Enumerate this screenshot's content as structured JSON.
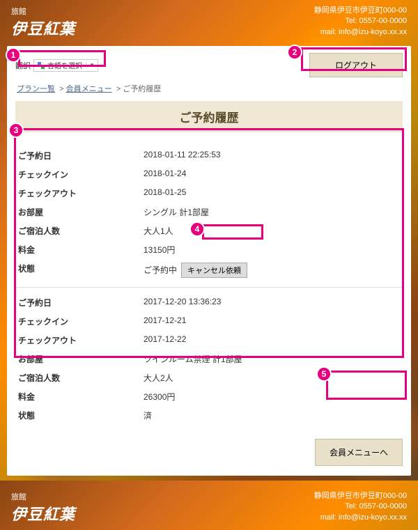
{
  "header": {
    "logo_sub": "旅館",
    "logo_main": "伊豆紅葉",
    "address": "静岡県伊豆市伊豆町000-00",
    "tel": "Tel: 0557-00-0000",
    "mail": "mail: info@izu-koyo.xx.xx"
  },
  "translate": {
    "label": "翻訳",
    "button": "言語を選択"
  },
  "logout": "ログアウト",
  "breadcrumb": {
    "plan_list": "プラン一覧",
    "member_menu": "会員メニュー",
    "current": "ご予約履歴",
    "sep": ">"
  },
  "page_title": "ご予約履歴",
  "labels": {
    "reserved_at": "ご予約日",
    "checkin": "チェックイン",
    "checkout": "チェックアウト",
    "room": "お部屋",
    "guests": "ご宿泊人数",
    "price": "料金",
    "status": "状態"
  },
  "cancel_button": "キャンセル依頼",
  "reservations": [
    {
      "reserved_at": "2018-01-11 22:25:53",
      "checkin": "2018-01-24",
      "checkout": "2018-01-25",
      "room": "シングル 計1部屋",
      "guests": "大人1人",
      "price": "13150円",
      "status": "ご予約中",
      "cancelable": true
    },
    {
      "reserved_at": "2017-12-20 13:36:23",
      "checkin": "2017-12-21",
      "checkout": "2017-12-22",
      "room": "ツインルーム禁煙 計1部屋",
      "guests": "大人2人",
      "price": "26300円",
      "status": "済",
      "cancelable": false
    }
  ],
  "back_button": "会員メニューへ",
  "callouts": [
    "1",
    "2",
    "3",
    "4",
    "5"
  ]
}
